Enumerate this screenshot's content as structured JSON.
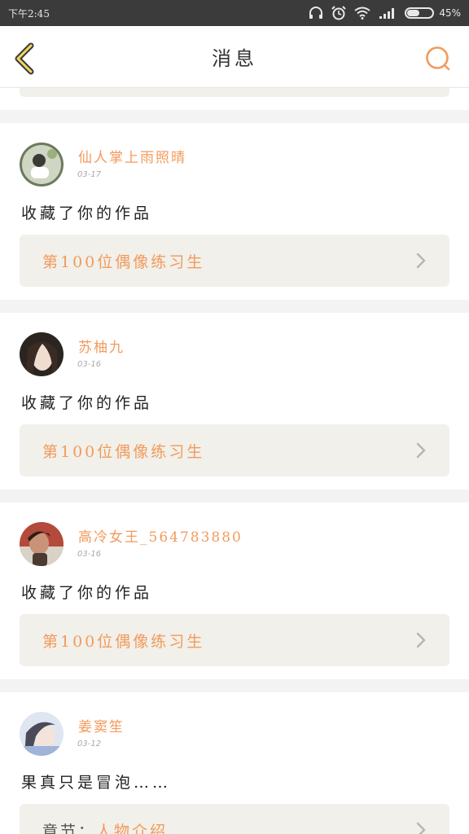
{
  "status_bar": {
    "time": "下午2:45",
    "battery_text": "45%",
    "battery_level": 0.45
  },
  "nav": {
    "title": "消息",
    "back_icon": "chevron-left-icon",
    "search_icon": "search-icon"
  },
  "messages": [
    {
      "username": "仙人掌上雨照晴",
      "date": "03-17",
      "text": "收藏了你的作品",
      "ref_prefix": "",
      "ref_title": "第100位偶像练习生"
    },
    {
      "username": "苏柚九",
      "date": "03-16",
      "text": "收藏了你的作品",
      "ref_prefix": "",
      "ref_title": "第100位偶像练习生"
    },
    {
      "username": "高冷女王_564783880",
      "date": "03-16",
      "text": "收藏了你的作品",
      "ref_prefix": "",
      "ref_title": "第100位偶像练习生"
    },
    {
      "username": "姜窦笙",
      "date": "03-12",
      "text": "果真只是冒泡……",
      "ref_prefix": "章节：",
      "ref_title": "人物介绍"
    }
  ],
  "colors": {
    "accent": "#f39a5c",
    "status_bar_bg": "#3b3b3b",
    "ref_box_bg": "#f1f0ea"
  }
}
